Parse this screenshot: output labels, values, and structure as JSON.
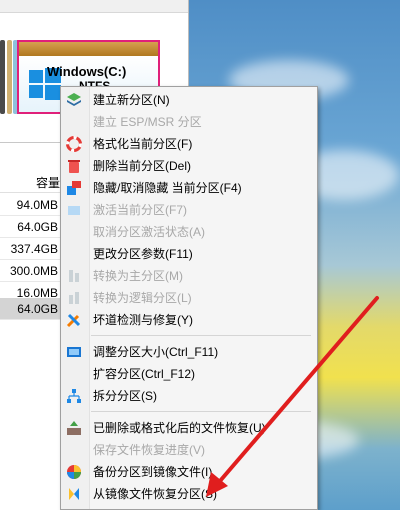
{
  "disk_map": {
    "windows_partition_label": "Windows(C:)",
    "windows_partition_sub": "NTFS"
  },
  "partition_list": {
    "capacity_header": "容量",
    "capacities": [
      "94.0MB",
      "64.0GB",
      "337.4GB",
      "300.0MB",
      "16.0MB",
      "64.0GB"
    ]
  },
  "context_menu": {
    "items": [
      {
        "label": "建立新分区(N)",
        "enabled": true,
        "icon": "layers-new-icon"
      },
      {
        "label": "建立 ESP/MSR 分区",
        "enabled": false,
        "icon": "none"
      },
      {
        "label": "格式化当前分区(F)",
        "enabled": true,
        "icon": "lifebuoy-format-icon"
      },
      {
        "label": "删除当前分区(Del)",
        "enabled": true,
        "icon": "trash-delete-icon"
      },
      {
        "label": "隐藏/取消隐藏 当前分区(F4)",
        "enabled": true,
        "icon": "hide-partition-icon"
      },
      {
        "label": "激活当前分区(F7)",
        "enabled": false,
        "icon": "activate-icon"
      },
      {
        "label": "取消分区激活状态(A)",
        "enabled": false,
        "icon": "none"
      },
      {
        "label": "更改分区参数(F11)",
        "enabled": true,
        "icon": "none"
      },
      {
        "label": "转换为主分区(M)",
        "enabled": false,
        "icon": "convert-primary-icon"
      },
      {
        "label": "转换为逻辑分区(L)",
        "enabled": false,
        "icon": "convert-logical-icon"
      },
      {
        "label": "坏道检测与修复(Y)",
        "enabled": true,
        "icon": "tools-repair-icon"
      },
      {
        "label": "调整分区大小(Ctrl_F11)",
        "enabled": true,
        "icon": "resize-icon"
      },
      {
        "label": "扩容分区(Ctrl_F12)",
        "enabled": true,
        "icon": "none"
      },
      {
        "label": "拆分分区(S)",
        "enabled": true,
        "icon": "split-tree-icon"
      },
      {
        "label": "已删除或格式化后的文件恢复(U)",
        "enabled": true,
        "icon": "recover-files-icon"
      },
      {
        "label": "保存文件恢复进度(V)",
        "enabled": false,
        "icon": "none"
      },
      {
        "label": "备份分区到镜像文件(I)",
        "enabled": true,
        "icon": "backup-image-icon"
      },
      {
        "label": "从镜像文件恢复分区(S)",
        "enabled": true,
        "icon": "restore-image-icon"
      }
    ]
  },
  "colors": {
    "partition_border": "#e0207a",
    "annotation_arrow": "#e01e1e",
    "menu_background": "#f5f5f5"
  }
}
